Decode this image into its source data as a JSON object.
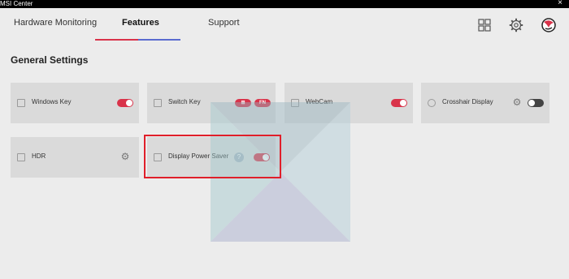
{
  "window": {
    "title": "MSI Center",
    "close_glyph": "×"
  },
  "nav": {
    "tabs": [
      {
        "label": "Hardware Monitoring",
        "active": false
      },
      {
        "label": "Features",
        "active": true
      },
      {
        "label": "Support",
        "active": false
      }
    ],
    "icons": [
      "grid-icon",
      "settings-icon",
      "msi-dragon-logo"
    ]
  },
  "section": {
    "title": "General Settings"
  },
  "cards": [
    {
      "label": "Windows Key",
      "control": "toggle",
      "state": "on"
    },
    {
      "label": "Switch Key",
      "control": "pills",
      "pills": [
        "⊞",
        "FN"
      ]
    },
    {
      "label": "WebCam",
      "control": "toggle",
      "state": "on"
    },
    {
      "label": "Crosshair Display",
      "control": "toggle",
      "state": "off",
      "has_gear": true
    },
    {
      "label": "HDR",
      "control": "gear"
    },
    {
      "label": "Display Power Saver",
      "control": "toggle",
      "state": "on",
      "has_help": true,
      "help_glyph": "?"
    }
  ],
  "colors": {
    "accent": "#d9334a",
    "nav_underline_secondary": "#5a6bd0",
    "highlight_box": "#e01f2a",
    "card_bg": "#dadada",
    "page_bg": "#ececec"
  }
}
